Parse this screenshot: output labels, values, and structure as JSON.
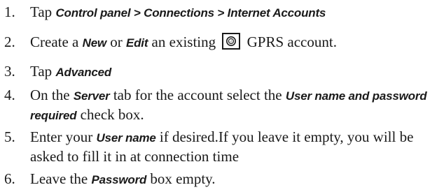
{
  "steps": [
    {
      "number": "1.",
      "t1": "Tap ",
      "u1": "Control panel > Connections > Internet Accounts"
    },
    {
      "number": "2.",
      "t1": "Create a ",
      "u1": "New",
      "t2": " or ",
      "u2": "Edit",
      "t3": " an existing ",
      "icon": "gprs-account-icon",
      "t4": " GPRS account."
    },
    {
      "number": "3.",
      "t1": "Tap ",
      "u1": "Advanced"
    },
    {
      "number": "4.",
      "t1": "On the ",
      "u1": "Server",
      "t2": " tab for the account select the ",
      "u2": "User name and password required",
      "t3": " check box."
    },
    {
      "number": "5.",
      "t1": "Enter your ",
      "u1": "User name",
      "t2": " if desired.If you leave it empty, you will be asked to fill it in at connection time"
    },
    {
      "number": "6.",
      "t1": "Leave the ",
      "u1": "Password",
      "t2": " box empty."
    }
  ]
}
